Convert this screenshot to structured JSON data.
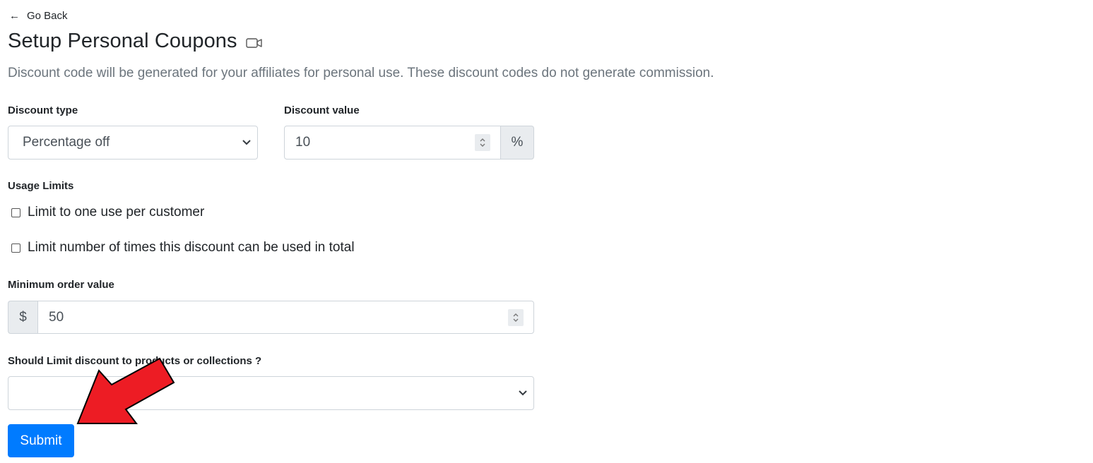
{
  "nav": {
    "back_label": "Go Back"
  },
  "header": {
    "title": "Setup Personal Coupons",
    "subtitle": "Discount code will be generated for your affiliates for personal use. These discount codes do not generate commission."
  },
  "form": {
    "discount_type": {
      "label": "Discount type",
      "selected": "Percentage off"
    },
    "discount_value": {
      "label": "Discount value",
      "value": "10",
      "suffix": "%"
    },
    "usage_limits": {
      "label": "Usage Limits",
      "options": [
        {
          "label": "Limit to one use per customer",
          "checked": false
        },
        {
          "label": "Limit number of times this discount can be used in total",
          "checked": false
        }
      ]
    },
    "minimum_order": {
      "label": "Minimum order value",
      "prefix": "$",
      "value": "50"
    },
    "limit_products": {
      "label": "Should Limit discount to products or collections ?",
      "selected": ""
    },
    "submit_label": "Submit"
  },
  "icons": {
    "back": "arrow-left-icon",
    "video": "video-camera-icon",
    "dropdown": "chevron-down-icon",
    "spinner": "spinner-updown-icon",
    "annotation": "red-arrow-pointer"
  },
  "colors": {
    "primary": "#007bff",
    "muted_text": "#6c757d",
    "border": "#ced4da",
    "addon_bg": "#e9ecef",
    "annotation_arrow": "#ed1c24"
  }
}
